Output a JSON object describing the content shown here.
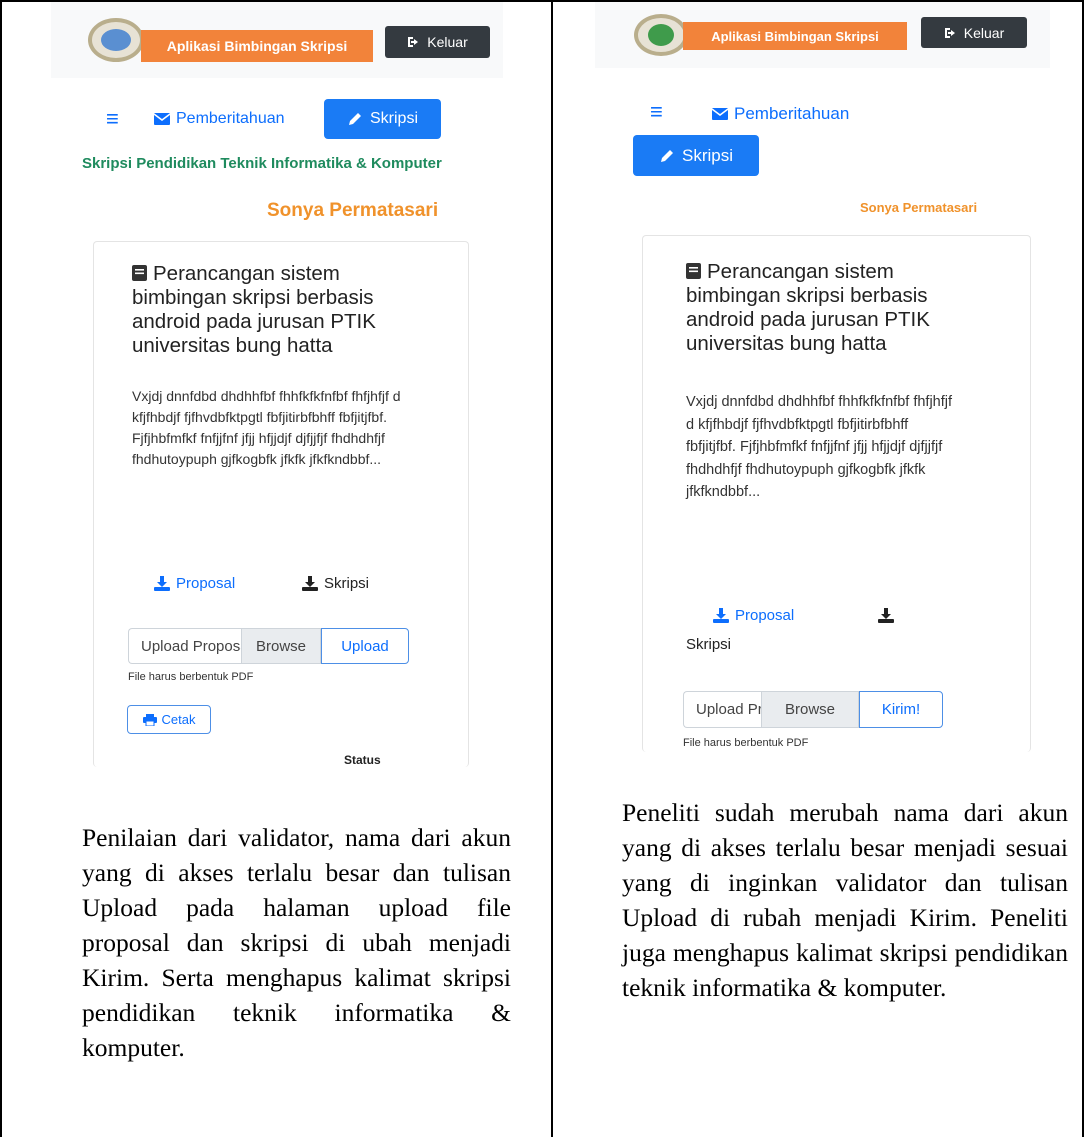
{
  "left": {
    "brand": "Aplikasi Bimbingan Skripsi",
    "logout_label": "Keluar",
    "nav_notifications": "Pemberitahuan",
    "nav_skripsi": "Skripsi",
    "subtitle": "Skripsi Pendidikan Teknik Informatika & Komputer",
    "username": "Sonya Permatasari",
    "card_title": "Perancangan sistem bimbingan skripsi berbasis android pada jurusan PTIK universitas bung hatta",
    "card_text": "Vxjdj dnnfdbd dhdhhfbf fhhfkfkfnfbf fhfjhfjf d kfjfhbdjf fjfhvdbfktpgtl fbfjitirbfbhff fbfjitjfbf. Fjfjhbfmfkf fnfjjfnf jfjj hfjjdjf djfjjfjf fhdhdhfjf fhdhutoypuph gjfkogbfk jfkfk jfkfkndbbf...",
    "dl_proposal": "Proposal",
    "dl_skripsi": "Skripsi",
    "upload_placeholder": "Upload Proposal",
    "browse_label": "Browse",
    "upload_button": "Upload",
    "helper": "File harus berbentuk PDF",
    "print_label": "Cetak",
    "status_label": "Status",
    "caption": "Penilaian dari validator, nama dari akun yang di akses terlalu besar dan tulisan Upload pada halaman upload file proposal dan skripsi di ubah menjadi Kirim. Serta menghapus kalimat skripsi pendidikan teknik informatika & komputer."
  },
  "right": {
    "brand": "Aplikasi Bimbingan Skripsi",
    "logout_label": "Keluar",
    "nav_notifications": "Pemberitahuan",
    "nav_skripsi": "Skripsi",
    "username": "Sonya Permatasari",
    "card_title": "Perancangan sistem bimbingan skripsi berbasis android pada jurusan PTIK universitas bung hatta",
    "card_text": "Vxjdj dnnfdbd dhdhhfbf fhhfkfkfnfbf fhfjhfjf d kfjfhbdjf fjfhvdbfktpgtl fbfjitirbfbhff fbfjitjfbf. Fjfjhbfmfkf fnfjjfnf jfjj hfjjdjf djfjjfjf fhdhdhfjf fhdhutoypuph gjfkogbfk jfkfk jfkfkndbbf...",
    "dl_proposal": "Proposal",
    "dl_skripsi": "Skripsi",
    "upload_placeholder": "Upload Proposal",
    "browse_label": "Browse",
    "upload_button": "Kirim!",
    "helper": "File harus berbentuk PDF",
    "caption": "Peneliti sudah merubah nama dari akun yang di akses terlalu besar menjadi sesuai yang di inginkan validator dan tulisan Upload di rubah menjadi Kirim. Peneliti juga menghapus kalimat skripsi pendidikan teknik informatika & komputer."
  },
  "colors": {
    "primary": "#1a7bf5",
    "brand_orange": "#f2833a",
    "subtitle_green": "#1f8b5e",
    "username_orange": "#f0922b",
    "logout_dark": "#343a40"
  }
}
